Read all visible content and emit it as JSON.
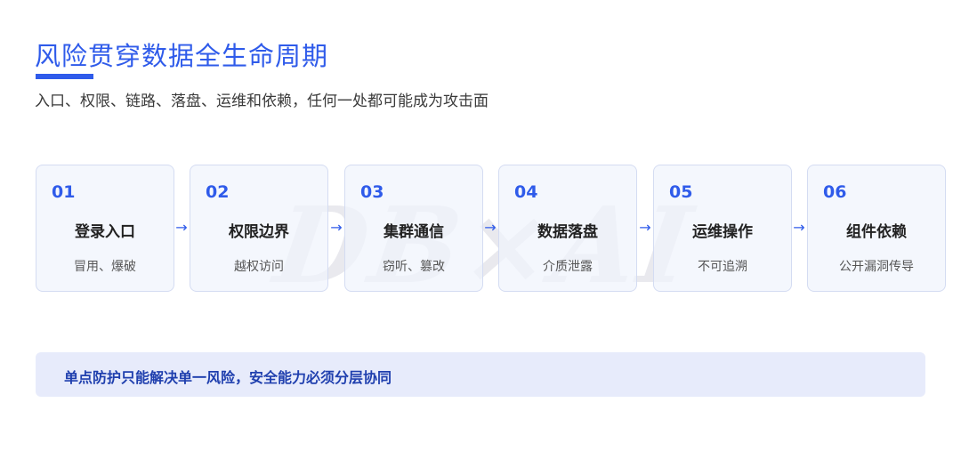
{
  "header": {
    "title": "风险贯穿数据全生命周期",
    "subtitle": "入口、权限、链路、落盘、运维和依赖，任何一处都可能成为攻击面"
  },
  "watermark": "DB×AI",
  "steps": [
    {
      "num": "01",
      "name": "登录入口",
      "desc": "冒用、爆破"
    },
    {
      "num": "02",
      "name": "权限边界",
      "desc": "越权访问"
    },
    {
      "num": "03",
      "name": "集群通信",
      "desc": "窃听、篡改"
    },
    {
      "num": "04",
      "name": "数据落盘",
      "desc": "介质泄露"
    },
    {
      "num": "05",
      "name": "运维操作",
      "desc": "不可追溯"
    },
    {
      "num": "06",
      "name": "组件依赖",
      "desc": "公开漏洞传导"
    }
  ],
  "arrow_glyph": "→",
  "callout": {
    "text": "单点防护只能解决单一风险，安全能力必须分层协同"
  },
  "colors": {
    "accent": "#2f5bea",
    "card_border": "#d4dcf2",
    "callout_bg": "#e7ebfb"
  }
}
